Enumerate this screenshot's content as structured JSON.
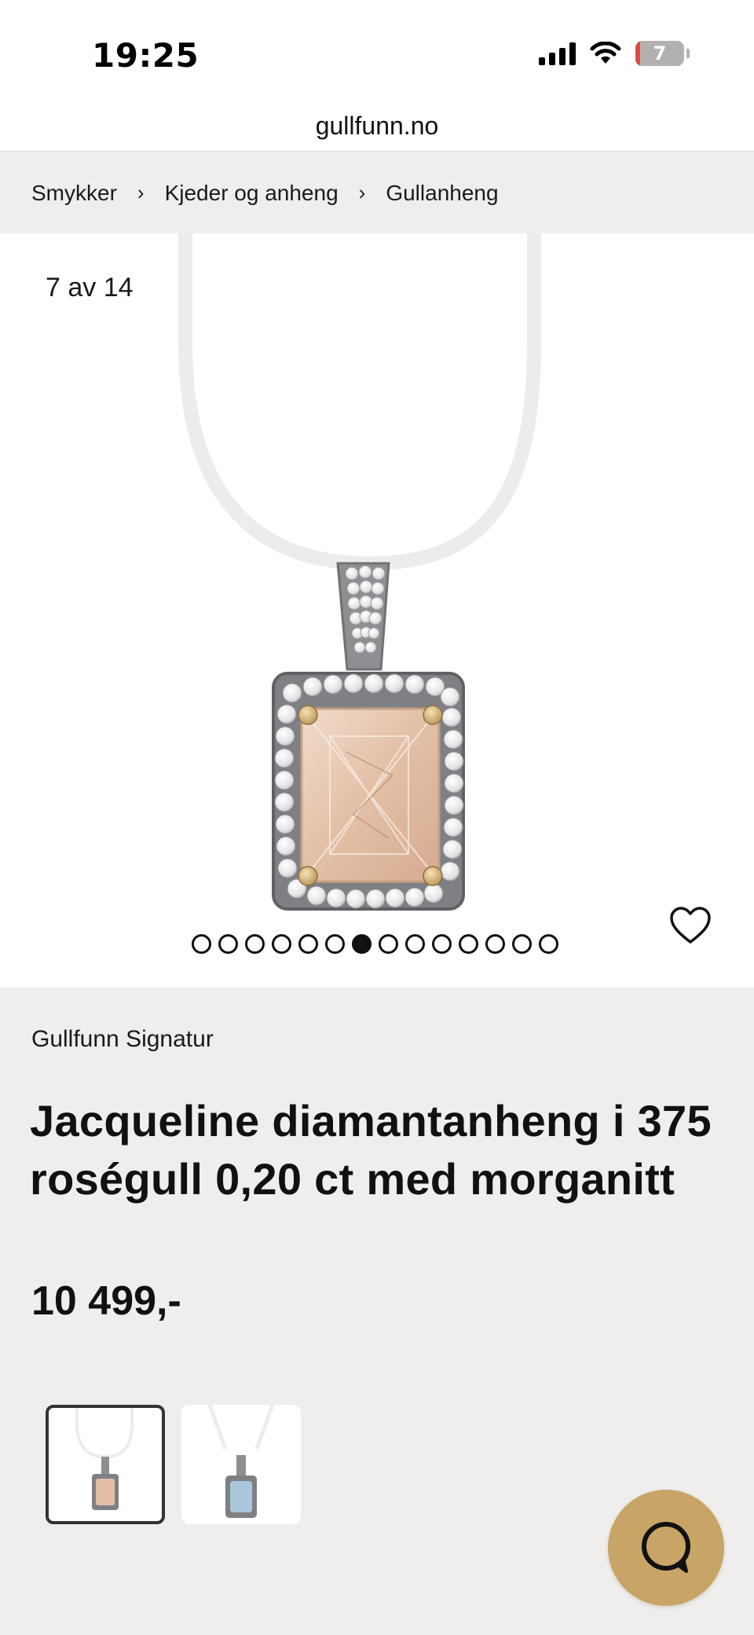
{
  "status_bar": {
    "time": "19:25",
    "battery": "7"
  },
  "browser": {
    "url": "gullfunn.no"
  },
  "breadcrumb": [
    {
      "label": "Smykker"
    },
    {
      "label": "Kjeder og anheng"
    },
    {
      "label": "Gullanheng"
    }
  ],
  "breadcrumb_separator": "›",
  "gallery": {
    "counter": "7 av 14",
    "current_index": 7,
    "total_images": 14
  },
  "product": {
    "brand": "Gullfunn Signatur",
    "title": "Jacqueline diamantanheng i 375 roségull 0,20 ct med morganitt",
    "price": "10 499,-"
  },
  "variants": [
    {
      "stone": "morganitt",
      "selected": true
    },
    {
      "stone": "akvamarin",
      "selected": false
    }
  ],
  "colors": {
    "page_bg": "#f0eeec",
    "chat_button": "#c8a566",
    "morganite": "#e6c7b0",
    "aquamarine": "#a9c6da"
  },
  "icons": {
    "heart": "heart-icon",
    "chat": "chat-icon",
    "wifi": "wifi-icon",
    "signal": "signal-icon",
    "battery": "battery-icon"
  }
}
